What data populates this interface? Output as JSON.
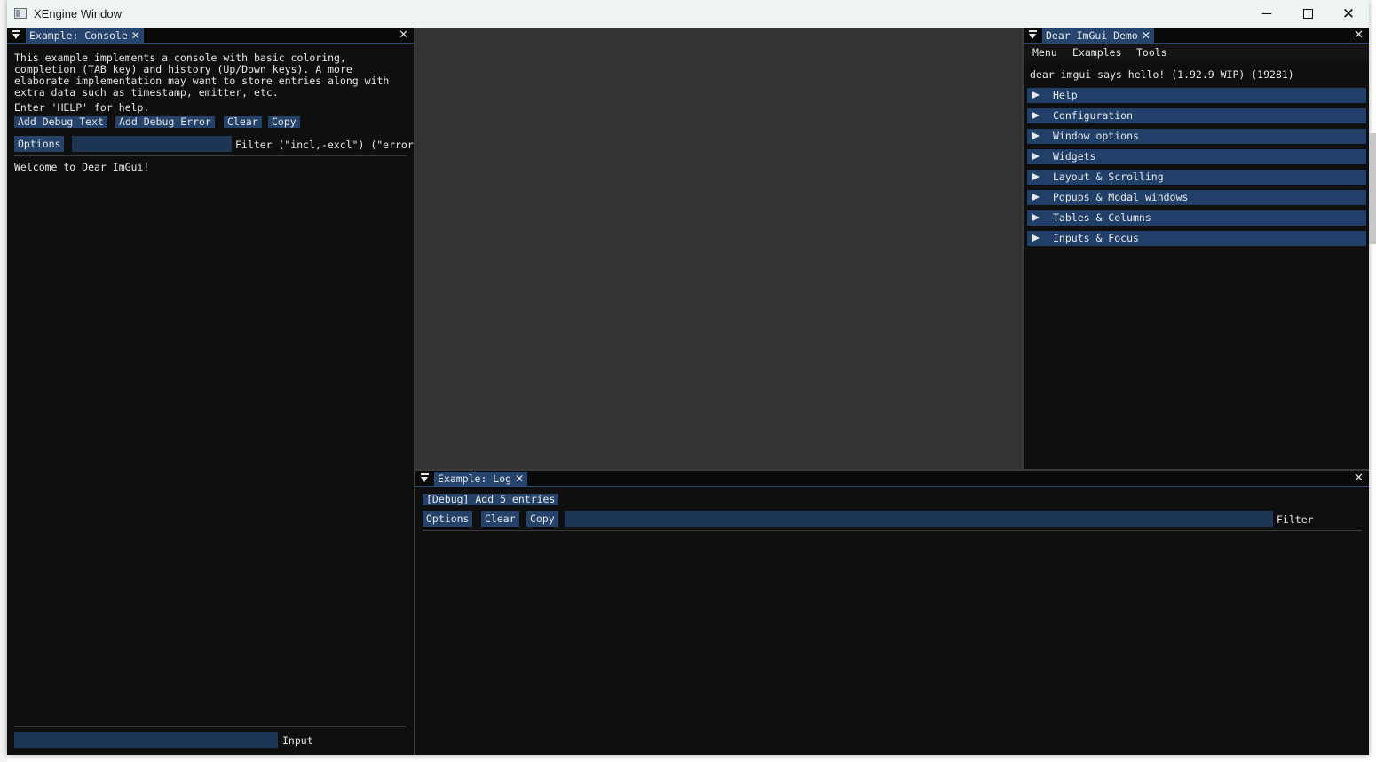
{
  "window": {
    "title": "XEngine Window",
    "controls": {
      "minimize": "─",
      "close": "✕"
    }
  },
  "console": {
    "tab_label": "Example: Console",
    "description": [
      "This example implements a console with basic coloring,",
      "completion (TAB key) and history (Up/Down keys). A more",
      "elaborate implementation may want to store entries along with",
      "extra data such as timestamp, emitter, etc."
    ],
    "help_hint": "Enter 'HELP' for help.",
    "buttons": [
      "Add Debug Text",
      "Add Debug Error",
      "Clear",
      "Copy"
    ],
    "options_label": "Options",
    "filter_value": "",
    "filter_label": "Filter (\"incl,-excl\") (\"error",
    "log_lines": [
      "Welcome to Dear ImGui!"
    ],
    "input_value": "",
    "input_label": "Input"
  },
  "demo": {
    "tab_label": "Dear ImGui Demo",
    "menu": [
      "Menu",
      "Examples",
      "Tools"
    ],
    "hello_text": "dear imgui says hello! (1.92.9 WIP) (19281)",
    "sections": [
      "Help",
      "Configuration",
      "Window options",
      "Widgets",
      "Layout & Scrolling",
      "Popups & Modal windows",
      "Tables & Columns",
      "Inputs & Focus"
    ]
  },
  "log": {
    "tab_label": "Example: Log",
    "add_entries_label": "[Debug] Add 5 entries",
    "buttons": [
      "Options",
      "Clear",
      "Copy"
    ],
    "filter_value": "",
    "filter_label": "Filter"
  },
  "icons": {
    "panel_menu": "window-menu-triangle-icon",
    "tab_close": "close-icon",
    "collapse_arrow": "tree-arrow-right-icon"
  },
  "colors": {
    "imgui_bg": "#0f0f0f",
    "button": "#24426a",
    "header": "#20406a",
    "frame_bg": "#1e3656",
    "dock_center": "#333333"
  }
}
